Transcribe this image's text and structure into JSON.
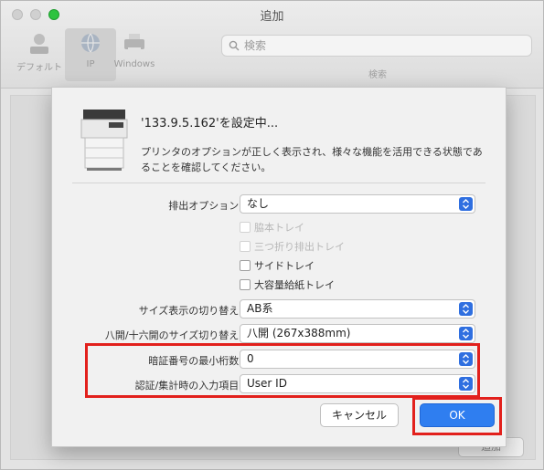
{
  "window": {
    "title": "追加",
    "toolbar": [
      {
        "label": "デフォルト",
        "icon": "default-printer-icon"
      },
      {
        "label": "IP",
        "icon": "ip-globe-icon"
      },
      {
        "label": "Windows",
        "icon": "windows-printer-icon"
      }
    ],
    "search": {
      "placeholder": "検索",
      "caption": "検索"
    },
    "add_button": "追加"
  },
  "sheet": {
    "title": "'133.9.5.162'を設定中...",
    "description": "プリンタのオプションが正しく表示され、様々な機能を活用できる状態であることを確認してください。",
    "options": {
      "output": {
        "label": "排出オプション:",
        "value": "なし"
      },
      "checkboxes": [
        {
          "label": "脇本トレイ",
          "enabled": false,
          "checked": false
        },
        {
          "label": "三つ折り排出トレイ",
          "enabled": false,
          "checked": false
        },
        {
          "label": "サイドトレイ",
          "enabled": true,
          "checked": false
        },
        {
          "label": "大容量給紙トレイ",
          "enabled": true,
          "checked": false
        }
      ],
      "size_display": {
        "label": "サイズ表示の切り替え:",
        "value": "AB系"
      },
      "hachi_size": {
        "label": "八開/十六開のサイズ切り替え:",
        "value": "八開 (267x388mm)"
      },
      "pin_digits": {
        "label": "暗証番号の最小桁数:",
        "value": "0"
      },
      "auth_input": {
        "label": "認証/集計時の入力項目:",
        "value": "User ID"
      }
    },
    "buttons": {
      "cancel": "キャンセル",
      "ok": "OK"
    }
  },
  "colors": {
    "accent": "#2f7ef0",
    "highlight": "#e2201c"
  }
}
